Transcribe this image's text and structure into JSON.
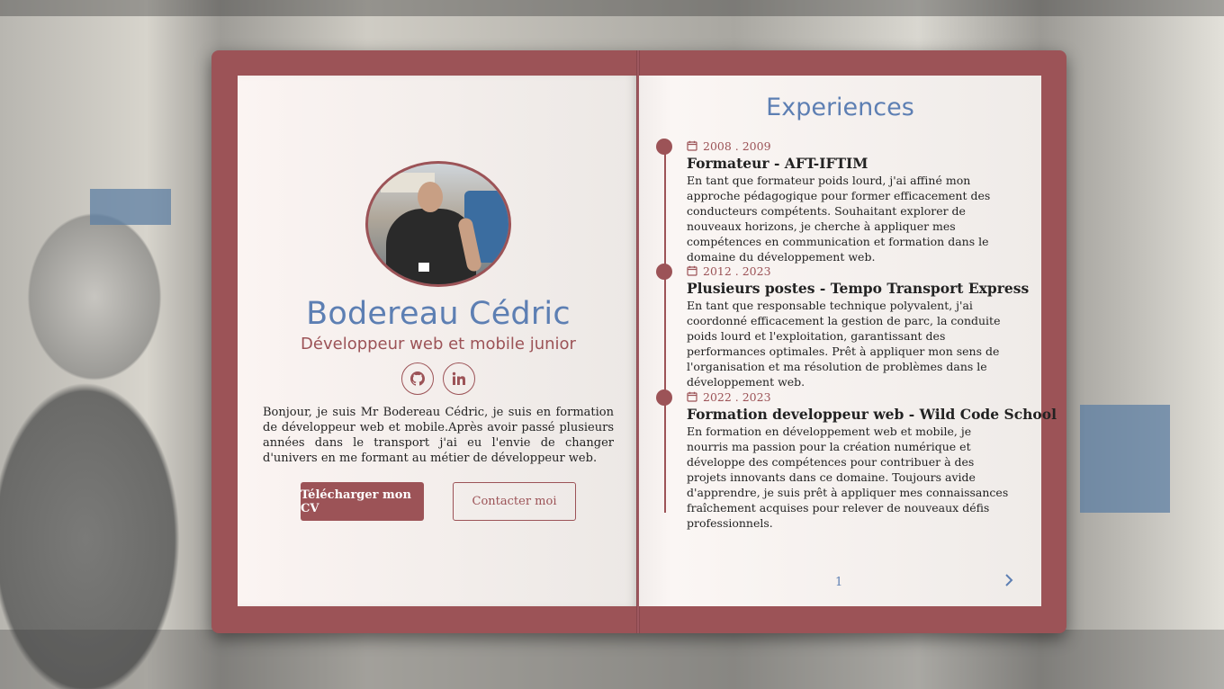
{
  "profile": {
    "name": "Bodereau Cédric",
    "role": "Développeur web et mobile junior",
    "intro": "Bonjour, je suis Mr Bodereau Cédric, je suis en formation de développeur web et mobile.Après avoir passé plusieurs années dans le transport j'ai eu l'envie de changer d'univers en me formant au métier de développeur web.",
    "socials": [
      {
        "icon": "github-icon"
      },
      {
        "icon": "linkedin-icon"
      }
    ],
    "buttons": {
      "cv_label": "Télécharger mon CV",
      "contact_label": "Contacter moi"
    }
  },
  "experiences": {
    "title": "Experiences",
    "items": [
      {
        "date": "2008 . 2009",
        "title": "Formateur - AFT-IFTIM",
        "description": "En tant que formateur poids lourd, j'ai affiné mon approche pédagogique pour former efficacement des conducteurs compétents. Souhaitant explorer de nouveaux horizons, je cherche à appliquer mes compétences en communication et formation dans le domaine du développement web."
      },
      {
        "date": "2012 . 2023",
        "title": "Plusieurs postes - Tempo Transport Express",
        "description": "En tant que responsable technique polyvalent, j'ai coordonné efficacement la gestion de parc, la conduite poids lourd et l'exploitation, garantissant des performances optimales. Prêt à appliquer mon sens de l'organisation et ma résolution de problèmes dans le développement web."
      },
      {
        "date": "2022 . 2023",
        "title": "Formation developpeur web - Wild Code School",
        "description": "En formation en développement web et mobile, je nourris ma passion pour la création numérique et développe des compétences pour contribuer à des projets innovants dans ce domaine. Toujours avide d'apprendre, je suis prêt à appliquer mes connaissances fraîchement acquises pour relever de nouveaux défis professionnels."
      }
    ]
  },
  "pagination": {
    "page": "1",
    "next_icon": "chevron-right-icon"
  },
  "colors": {
    "accent": "#9c5357",
    "title_blue": "#5d7fb3",
    "page": "#f4efec"
  }
}
